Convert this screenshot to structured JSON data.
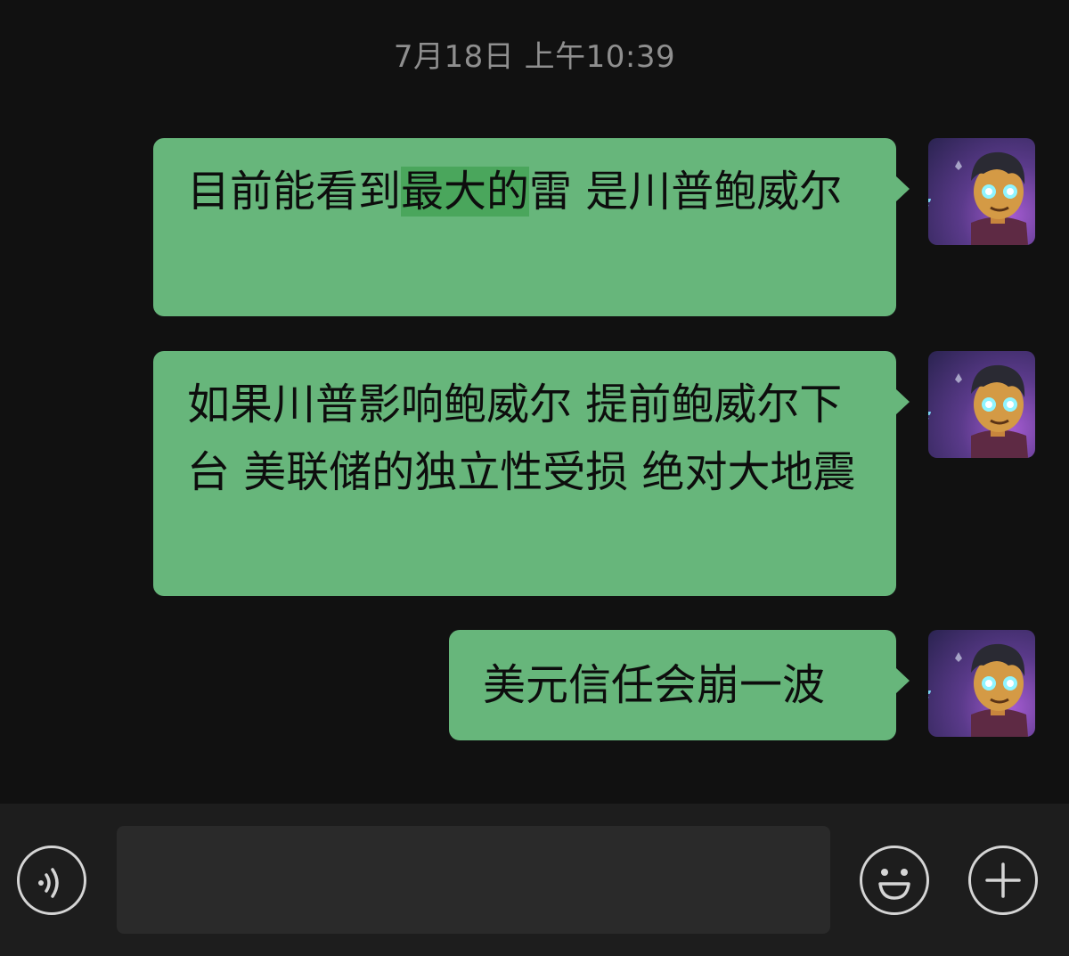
{
  "chat": {
    "timestamp": "7月18日 上午10:39",
    "messages": [
      {
        "sender": "self",
        "segments": [
          "目前能看到",
          "最大的",
          "雷 是川普鲍威尔"
        ],
        "highlighted_segment": 1
      },
      {
        "sender": "self",
        "text": "如果川普影响鲍威尔 提前鲍威尔下台 美联储的独立性受损 绝对大地震"
      },
      {
        "sender": "self",
        "text": "美元信任会崩一波"
      }
    ]
  },
  "input_bar": {
    "icons": [
      "voice-icon",
      "emoji-icon",
      "plus-icon"
    ],
    "text_value": ""
  },
  "colors": {
    "background": "#111111",
    "bubble": "#67b67b",
    "highlight": "#4aa65c",
    "input_bar": "#1d1d1d"
  }
}
